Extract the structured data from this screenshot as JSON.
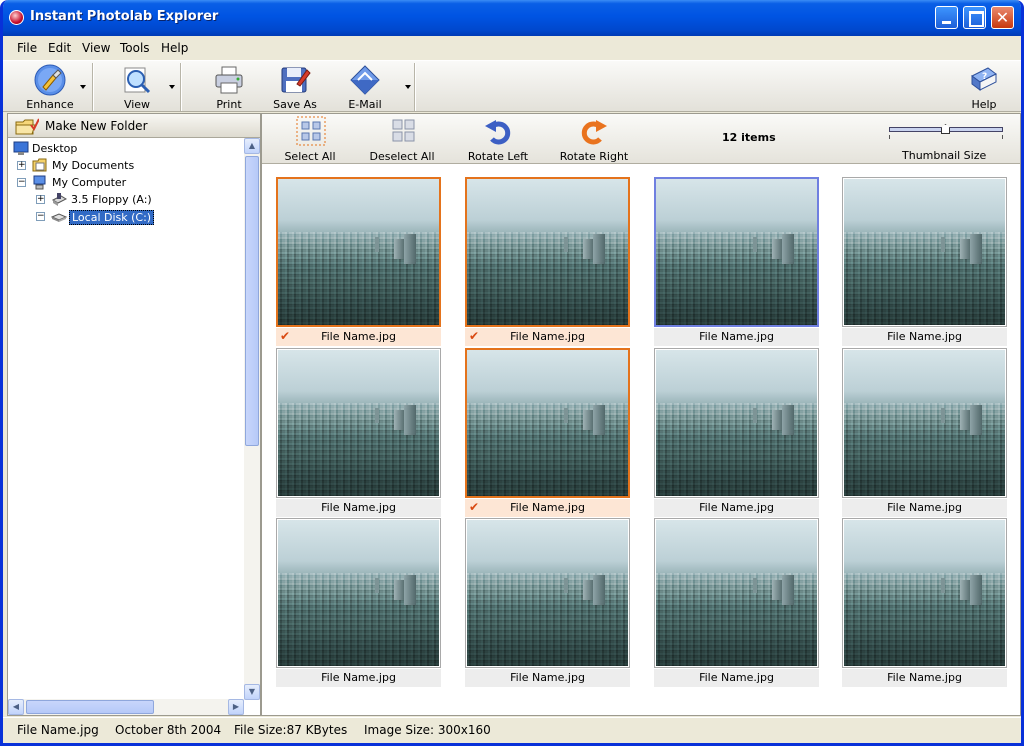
{
  "window": {
    "title": "Instant Photolab Explorer"
  },
  "menu": [
    "File",
    "Edit",
    "View",
    "Tools",
    "Help"
  ],
  "toolbar": {
    "enhance": "Enhance",
    "view": "View",
    "print": "Print",
    "save_as": "Save As",
    "email": "E-Mail",
    "help": "Help"
  },
  "sidebar": {
    "new_folder": "Make New Folder",
    "tree": [
      {
        "label": "Desktop",
        "icon": "desktop-icon"
      },
      {
        "label": "My Documents",
        "icon": "folder-icon",
        "expander": "+"
      },
      {
        "label": "My Computer",
        "icon": "computer-icon",
        "expander": "−"
      },
      {
        "label": "3.5 Floppy (A:)",
        "icon": "floppy-drive-icon",
        "expander": "+"
      },
      {
        "label": "Local Disk (C:)",
        "icon": "hard-disk-icon",
        "expander": "−",
        "selected": true
      }
    ]
  },
  "browser": {
    "select_all": "Select All",
    "deselect_all": "Deselect All",
    "rotate_left": "Rotate Left",
    "rotate_right": "Rotate Right",
    "items_count": "12 items",
    "thumbnail_size": "Thumbnail Size",
    "thumbnails": [
      {
        "name": "File Name.jpg",
        "state": "selected"
      },
      {
        "name": "File Name.jpg",
        "state": "selected"
      },
      {
        "name": "File Name.jpg",
        "state": "focused"
      },
      {
        "name": "File Name.jpg",
        "state": "normal"
      },
      {
        "name": "File Name.jpg",
        "state": "normal"
      },
      {
        "name": "File Name.jpg",
        "state": "selected"
      },
      {
        "name": "File Name.jpg",
        "state": "normal"
      },
      {
        "name": "File Name.jpg",
        "state": "normal"
      },
      {
        "name": "File Name.jpg",
        "state": "normal"
      },
      {
        "name": "File Name.jpg",
        "state": "normal"
      },
      {
        "name": "File Name.jpg",
        "state": "normal"
      },
      {
        "name": "File Name.jpg",
        "state": "normal"
      }
    ]
  },
  "status": {
    "file_name": "File Name.jpg",
    "date": "October 8th 2004",
    "file_size": "File Size:87 KBytes",
    "image_size": "Image Size: 300x160"
  },
  "colors": {
    "title_bar": "#0054e3",
    "selection_border": "#e4731c",
    "focus_border": "#6f7fe0",
    "tree_selection": "#316ac5"
  }
}
